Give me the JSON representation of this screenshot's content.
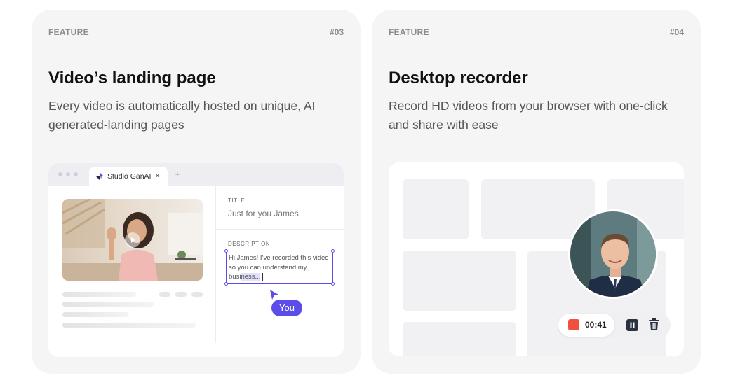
{
  "cards": [
    {
      "feature_label": "FEATURE",
      "number": "#03",
      "title": "Video’s landing page",
      "description": "Every video is automatically hosted on unique, AI generated-landing pages",
      "browser": {
        "tab_label": "Studio GanAI",
        "tab_close": "×",
        "new_tab": "+",
        "title_label": "TITLE",
        "title_value": "Just for you James",
        "description_label": "DESCRIPTION",
        "description_text_before": "Hi James! I’ve recorded this video so you can understand my busi",
        "description_text_selected": "ness...",
        "cursor_tag": "You"
      }
    },
    {
      "feature_label": "FEATURE",
      "number": "#04",
      "title": "Desktop recorder",
      "description": "Record HD videos from your browser with one-click and share with ease",
      "recorder": {
        "time": "00:41",
        "stop_color": "#f0503c",
        "pause_icon": "pause-icon",
        "trash_icon": "trash-icon"
      }
    }
  ],
  "colors": {
    "accent": "#5b4ee8",
    "card_bg": "#f5f5f5",
    "record_red": "#f0503c"
  }
}
